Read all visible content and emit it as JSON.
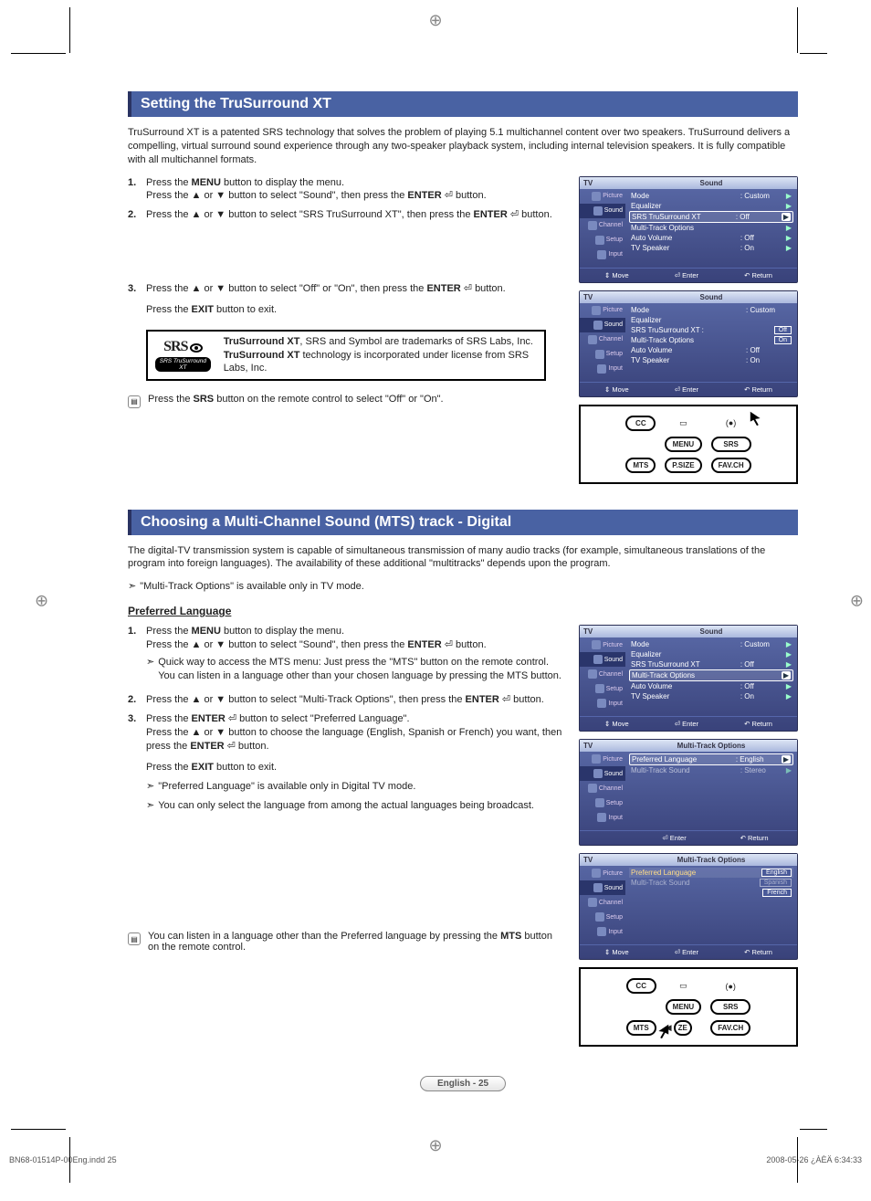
{
  "section1": {
    "title": "Setting the TruSurround XT",
    "intro": "TruSurround XT is a patented SRS technology that solves the problem of playing 5.1 multichannel content over two speakers. TruSurround delivers a compelling, virtual surround sound experience through any two-speaker playback system, including internal television speakers. It is fully compatible with all multichannel formats.",
    "steps": {
      "s1a": "Press the ",
      "s1_menu": "MENU",
      "s1b": " button to display the menu.",
      "s1c": "Press the ▲ or ▼ button to select \"Sound\", then press the ",
      "s1_enter": "ENTER",
      "s1d": " ⏎ button.",
      "s2a": "Press the ▲ or ▼ button to select \"SRS TruSurround XT\", then press the ",
      "s2_enter": "ENTER",
      "s2b": " ⏎ button.",
      "s3a": "Press the ▲ or ▼ button to select \"Off\" or \"On\", then press the ",
      "s3_enter": "ENTER",
      "s3b": " ⏎ button.",
      "s3c": "Press the ",
      "s3_exit": "EXIT",
      "s3d": " button to exit."
    },
    "callout": {
      "logo_big": "SRS",
      "logo_tag": "SRS TruSurround XT",
      "line1a": "TruSurround XT",
      "line1b": ", SRS and ",
      "line1c": " Symbol are trademarks of SRS Labs, Inc.",
      "line2a": "TruSurround XT",
      "line2b": " technology is incorporated under license from SRS Labs, Inc."
    },
    "remote_note_a": "Press the ",
    "remote_note_srs": "SRS",
    "remote_note_b": " button on the remote control to select \"Off\" or \"On\"."
  },
  "section2": {
    "title": "Choosing a Multi-Channel Sound (MTS) track - Digital",
    "intro": "The digital-TV transmission system is capable of simultaneous transmission of many audio tracks (for example, simultaneous translations of the program into foreign languages). The availability of these additional \"multitracks\" depends upon the program.",
    "note1": "\"Multi-Track Options\" is available only in TV mode.",
    "sub": "Preferred Language",
    "s1a": "Press the ",
    "s1_menu": "MENU",
    "s1b": " button to display the menu.",
    "s1c": "Press the ▲ or ▼ button to select \"Sound\", then press the ",
    "s1_enter": "ENTER",
    "s1d": " ⏎ button.",
    "s1_sub": "Quick way to access the MTS menu: Just press the \"MTS\" button on the remote control. You can listen in a language other than your chosen language by pressing the MTS button.",
    "s2": "Press the ▲ or ▼ button to select \"Multi-Track Options\", then press the ",
    "s2_enter": "ENTER",
    "s2b": " ⏎ button.",
    "s3a": "Press the ",
    "s3_enter": "ENTER",
    "s3b": " ⏎ button to select \"Preferred Language\".",
    "s3c": "Press the ▲ or ▼ button to choose the language (English, Spanish or French) you want, then press the ",
    "s3_enter2": "ENTER",
    "s3d": " ⏎ button.",
    "s3e": "Press the ",
    "s3_exit": "EXIT",
    "s3f": " button to exit.",
    "note2": "\"Preferred Language\" is available only in Digital TV mode.",
    "note3": "You can only select the language from among the actual languages being broadcast.",
    "remote_note": "You can listen in a language other than the Preferred language by pressing the ",
    "remote_note_mts": "MTS",
    "remote_note_b": " button on the remote control."
  },
  "osd": {
    "tv": "TV",
    "sound": "Sound",
    "mto": "Multi-Track Options",
    "side": {
      "picture": "Picture",
      "sound": "Sound",
      "channel": "Channel",
      "setup": "Setup",
      "input": "Input"
    },
    "rows": {
      "mode": "Mode",
      "mode_v": ": Custom",
      "eq": "Equalizer",
      "srs": "SRS TruSurround XT",
      "srs_v": ": Off",
      "srs_off": "Off",
      "srs_on": "On",
      "mto": "Multi-Track Options",
      "av": "Auto Volume",
      "av_v": ": Off",
      "tvspk": "TV Speaker",
      "tvspk_v": ": On",
      "pl": "Preferred Language",
      "pl_v": ": English",
      "mts": "Multi-Track Sound",
      "mts_v": ": Stereo",
      "eng": "English",
      "spa": "Spanish",
      "fre": "French"
    },
    "foot": {
      "move": "⇕ Move",
      "enter": "⏎ Enter",
      "ret": "↶ Return"
    }
  },
  "remote": {
    "cc": "CC",
    "menu": "MENU",
    "srs": "SRS",
    "mts": "MTS",
    "psize": "P.SIZE",
    "favch": "FAV.CH",
    "ze": "ZE"
  },
  "page_foot": "English - 25",
  "doc_foot_left": "BN68-01514P-00Eng.indd   25",
  "doc_foot_right": "2008-05-26   ¿ÀÈÄ 6:34:33"
}
